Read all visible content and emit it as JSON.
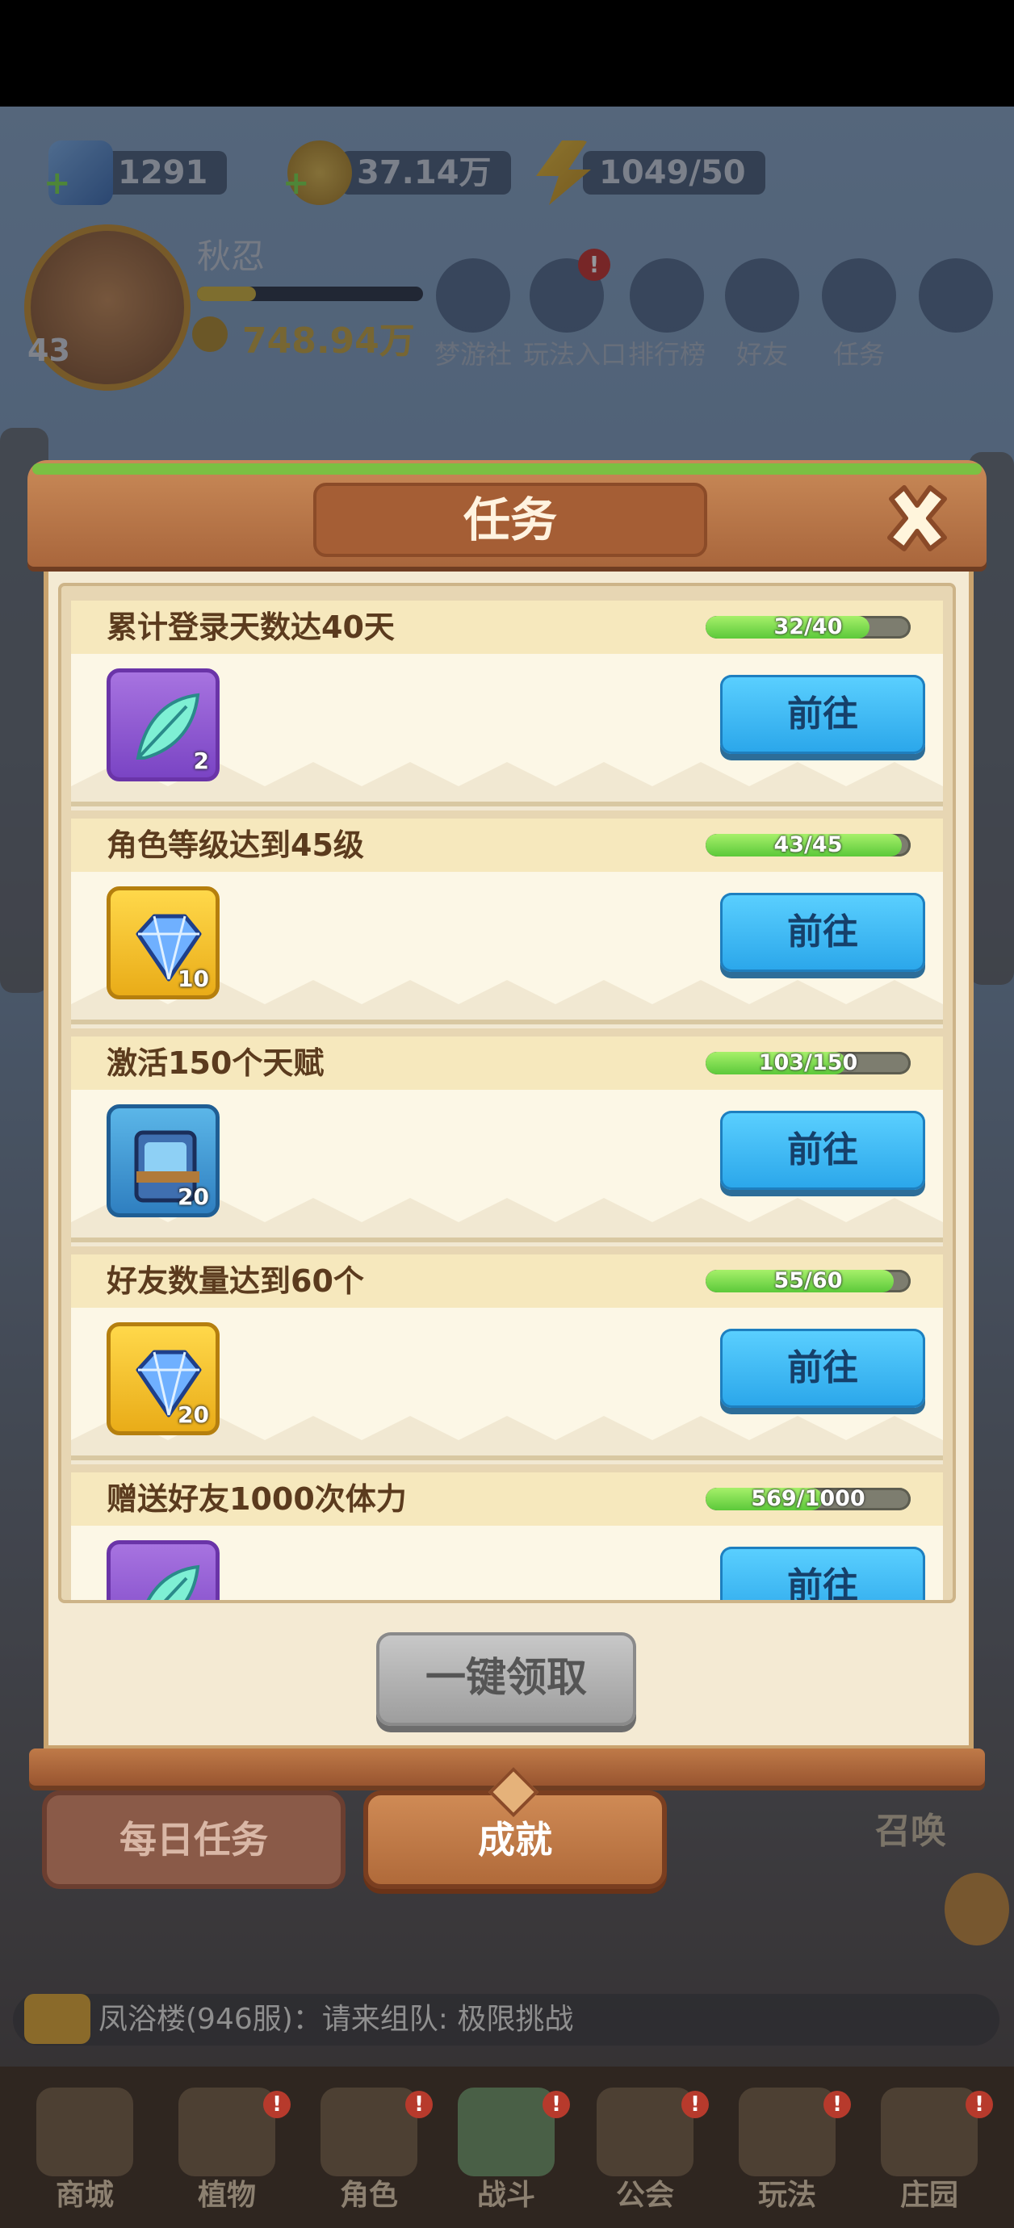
{
  "resources": [
    {
      "icon": "gem-icon",
      "value": "1291"
    },
    {
      "icon": "gold-coin-icon",
      "value": "37.14万"
    },
    {
      "icon": "energy-icon",
      "value": "1049/50"
    }
  ],
  "player": {
    "name": "秋忍",
    "level": "43",
    "gold": "748.94万",
    "exp_progress": 0.26
  },
  "top_menu": [
    {
      "label": "梦游社",
      "badge": ""
    },
    {
      "label": "玩法入口",
      "badge": "!"
    },
    {
      "label": "排行榜",
      "badge": ""
    },
    {
      "label": "好友",
      "badge": ""
    },
    {
      "label": "任务",
      "badge": ""
    }
  ],
  "modal": {
    "title": "任务",
    "tasks": [
      {
        "name": "累计登录天数达40天",
        "progress_text": "32/40",
        "progress": 0.8,
        "reward_icon": "feather-icon",
        "reward_count": "2",
        "button": "前往"
      },
      {
        "name": "角色等级达到45级",
        "progress_text": "43/45",
        "progress": 0.956,
        "reward_icon": "diamond-icon",
        "reward_count": "10",
        "button": "前往"
      },
      {
        "name": "激活150个天赋",
        "progress_text": "103/150",
        "progress": 0.687,
        "reward_icon": "book-icon",
        "reward_count": "20",
        "button": "前往"
      },
      {
        "name": "好友数量达到60个",
        "progress_text": "55/60",
        "progress": 0.917,
        "reward_icon": "diamond-icon",
        "reward_count": "20",
        "button": "前往"
      },
      {
        "name": "赠送好友1000次体力",
        "progress_text": "569/1000",
        "progress": 0.569,
        "reward_icon": "feather-icon",
        "reward_count": "",
        "button": "前往"
      }
    ],
    "claim_all": "一键领取",
    "tabs": {
      "daily": "每日任务",
      "achievement": "成就"
    }
  },
  "side_label": "召唤",
  "chat": {
    "text": "凤浴楼(946服)：请来组队: 极限挑战"
  },
  "bottom_nav": [
    {
      "label": "商城",
      "badge": ""
    },
    {
      "label": "植物",
      "badge": "!"
    },
    {
      "label": "角色",
      "badge": "!"
    },
    {
      "label": "战斗",
      "badge": "!"
    },
    {
      "label": "公会",
      "badge": "!"
    },
    {
      "label": "玩法",
      "badge": "!"
    },
    {
      "label": "庄园",
      "badge": "!"
    }
  ],
  "colors": {
    "accent_button": "#2aa6ea",
    "progress_fill": "#5cc93a",
    "modal_wood": "#a9663c"
  }
}
